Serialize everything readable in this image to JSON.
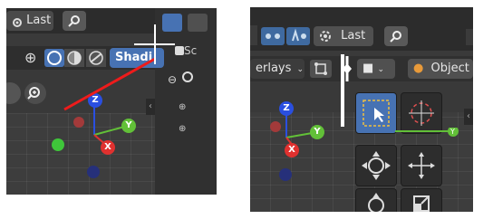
{
  "left": {
    "last_label": "Last",
    "shading_label": "Shadi",
    "props_label": "Sc"
  },
  "right": {
    "last_label": "Last",
    "overlays_label": "erlays",
    "object_label": "Object"
  },
  "gizmo": {
    "x_label": "X",
    "y_label": "Y",
    "z_label": "Z"
  },
  "colors": {
    "x_axis": "#e0312f",
    "y_axis": "#62c038",
    "z_axis": "#2a4fe0",
    "accent": "#4772b3"
  }
}
